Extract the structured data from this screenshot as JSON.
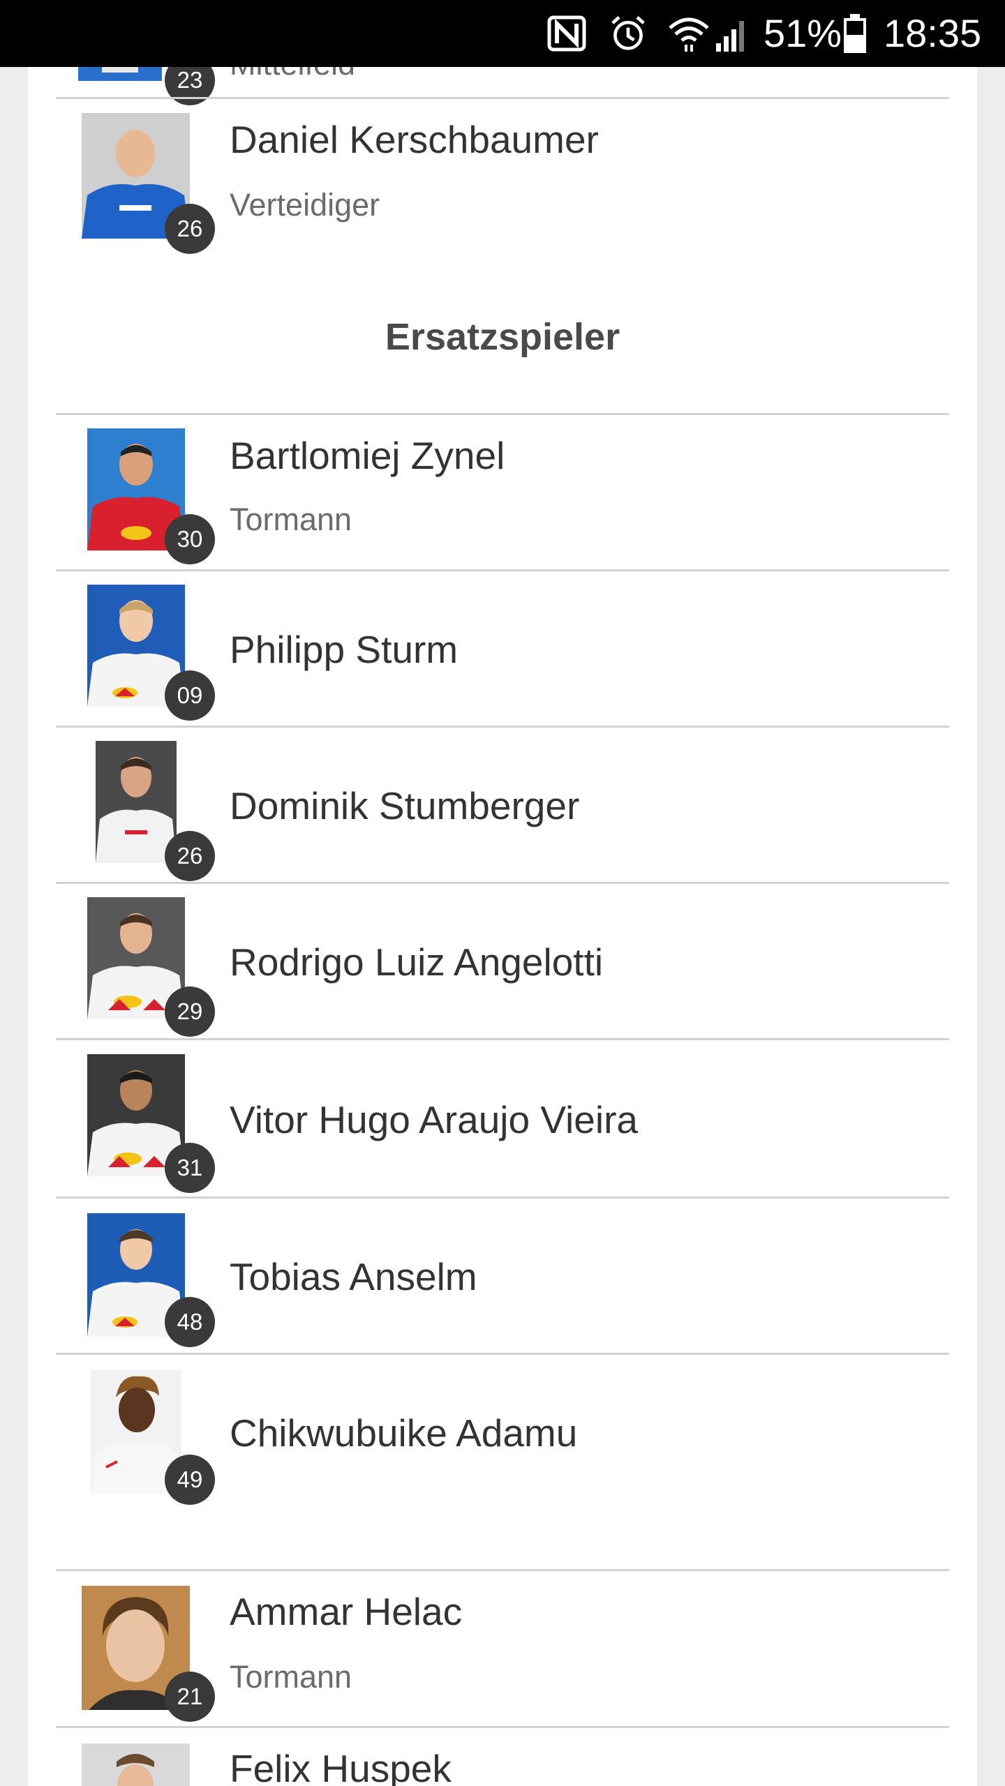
{
  "status_bar": {
    "battery": "51%",
    "time": "18:35",
    "icons": [
      "nfc-icon",
      "alarm-icon",
      "wifi-icon",
      "signal-icon",
      "battery-icon"
    ]
  },
  "top_players": [
    {
      "number": "23",
      "name": "",
      "position": "Mittelfeld",
      "photo_bg": "#1e5fb5"
    },
    {
      "number": "26",
      "name": "Daniel Kerschbaumer",
      "position": "Verteidiger",
      "photo_bg": "#cfcfcf"
    }
  ],
  "section": {
    "title": "Ersatzspieler"
  },
  "substitutes": [
    {
      "number": "30",
      "name": "Bartlomiej Zynel",
      "position": "Tormann",
      "photo_bg": "#2f7fd0"
    },
    {
      "number": "09",
      "name": "Philipp Sturm",
      "position": "",
      "photo_bg": "#1f5db8"
    },
    {
      "number": "26",
      "name": "Dominik Stumberger",
      "position": "",
      "photo_bg": "#4a4a4a"
    },
    {
      "number": "29",
      "name": "Rodrigo Luiz Angelotti",
      "position": "",
      "photo_bg": "#585858"
    },
    {
      "number": "31",
      "name": "Vitor Hugo Araujo Vieira",
      "position": "",
      "photo_bg": "#3a3a3a"
    },
    {
      "number": "48",
      "name": "Tobias Anselm",
      "position": "",
      "photo_bg": "#1d5db5"
    },
    {
      "number": "49",
      "name": "Chikwubuike Adamu",
      "position": "",
      "photo_bg": "#f2f2f2"
    }
  ],
  "bottom_players": [
    {
      "number": "21",
      "name": "Ammar Helac",
      "position": "Tormann",
      "photo_bg": "#c08a4e"
    },
    {
      "number": "",
      "name": "Felix Huspek",
      "position": "",
      "photo_bg": "#d9d9d9"
    }
  ],
  "colors": {
    "badge": "#3a3a3a",
    "divider": "#d2d2d2",
    "page_bg": "#ededed",
    "card_bg": "#ffffff"
  }
}
